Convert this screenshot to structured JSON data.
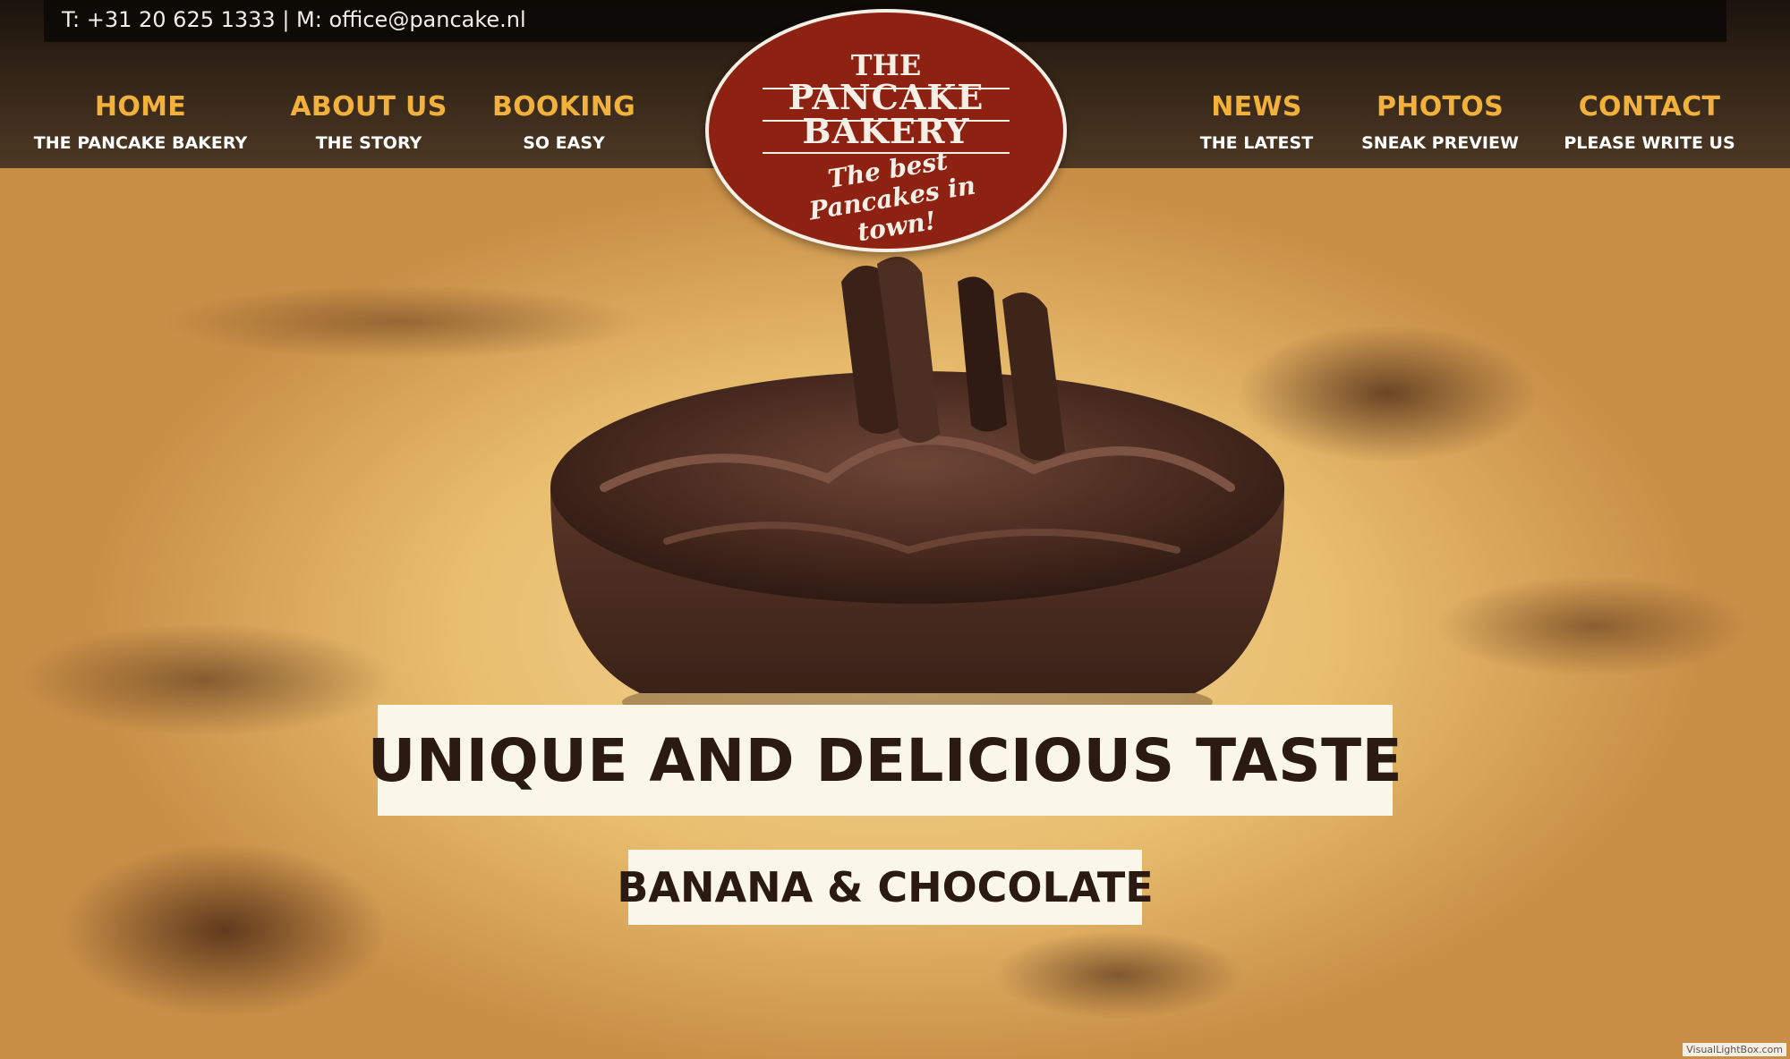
{
  "contact": {
    "text": "T: +31 20 625 1333 | M: office@pancake.nl"
  },
  "nav": {
    "home": {
      "title": "HOME",
      "sub": "THE PANCAKE BAKERY"
    },
    "about": {
      "title": "ABOUT US",
      "sub": "THE STORY"
    },
    "booking": {
      "title": "BOOKING",
      "sub": "SO EASY"
    },
    "news": {
      "title": "NEWS",
      "sub": "THE LATEST"
    },
    "photos": {
      "title": "PHOTOS",
      "sub": "SNEAK PREVIEW"
    },
    "contact": {
      "title": "CONTACT",
      "sub": "PLEASE WRITE US"
    }
  },
  "logo": {
    "the": "THE",
    "pancake": "PANCAKE",
    "bakery": "BAKERY",
    "tagline": "The best Pancakes in town!"
  },
  "hero": {
    "headline": "UNIQUE AND DELICIOUS TASTE",
    "subheadline": "BANANA & CHOCOLATE"
  },
  "watermark": "VisualLightBox.com",
  "colors": {
    "nav_accent": "#f2b13a",
    "logo_red": "#8d2213",
    "caption_bg": "#fbf6ea",
    "caption_text": "#2a1a12"
  }
}
